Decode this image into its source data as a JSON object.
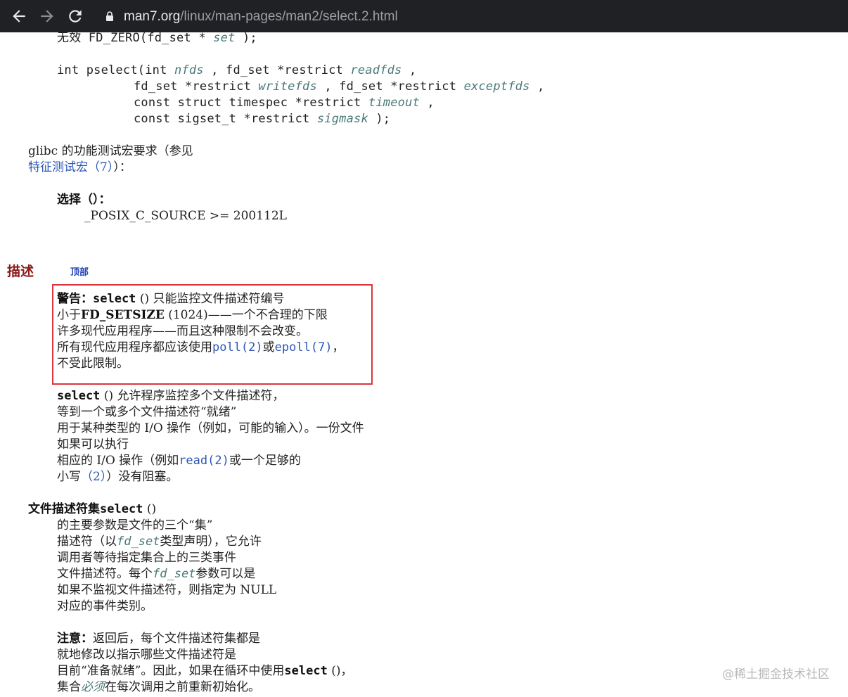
{
  "browser": {
    "url_host": "man7.org",
    "url_path": "/linux/man-pages/man2/select.2.html"
  },
  "synopsis": {
    "fdzero": {
      "prefix": "无效 FD_ZERO(fd_set * ",
      "arg": "set",
      "suffix": " );"
    },
    "pselect": [
      {
        "parts": [
          "int pselect(int ",
          "nfds",
          " , fd_set *restrict ",
          "readfds",
          " ,"
        ]
      },
      {
        "parts": [
          "fd_set *restrict ",
          "writefds",
          " , fd_set *restrict ",
          "exceptfds",
          " ,"
        ]
      },
      {
        "parts": [
          "const struct timespec *restrict ",
          "timeout",
          " ,"
        ]
      },
      {
        "parts": [
          "const sigset_t *restrict ",
          "sigmask",
          " );"
        ]
      }
    ],
    "glibc_line1": "glibc 的功能测试宏要求（参见",
    "glibc_link": "特征测试宏（7）",
    "glibc_line2_suffix": "）：",
    "select_label": "选择（）：",
    "posix": "_POSIX_C_SOURCE >= 200112L"
  },
  "description": {
    "title": "描述",
    "top_link": "顶部",
    "warning": {
      "bold_label": "警告：",
      "l1_code": "select",
      "l1_rest": " () 只能监控文件描述符编号",
      "l2_prefix": "小于",
      "l2_bold": "FD_SETSIZE",
      "l2_rest": " (1024)——一个不合理的下限",
      "l3": "许多现代应用程序——而且这种限制不会改变。",
      "l4_prefix": "所有现代应用程序都应该使用",
      "l4_link1": "poll(2)",
      "l4_mid": "或",
      "l4_link2": "epoll(7)",
      "l4_suffix": "，",
      "l5": "不受此限制。"
    },
    "para1": {
      "l1_code": "select",
      "l1_rest": " () 允许程序监控多个文件描述符，",
      "l2": "等到一个或多个文件描述符“就绪”",
      "l3": "用于某种类型的 I/O 操作（例如，可能的输入）。一份文件",
      "l4": "如果可以执行",
      "l5_prefix": "相应的 I/O 操作（例如",
      "l5_link": "read(2)",
      "l5_rest": "或一个足够的",
      "l6_prefix": "小写",
      "l6_link": "（2）",
      "l6_rest": "）没有阻塞。"
    },
    "fdsets": {
      "heading_prefix": "文件描述符集",
      "heading_code": "select",
      "heading_suffix": " ()",
      "l1": "的主要参数是文件的三个“集”",
      "l2_prefix": "描述符（以",
      "l2_it": "fd_set",
      "l2_rest": "类型声明），它允许",
      "l3": "调用者等待指定集合上的三类事件",
      "l4_prefix": "文件描述符。每个",
      "l4_it": "fd_set",
      "l4_rest": "参数可以是",
      "l5": "如果不监视文件描述符，则指定为 NULL",
      "l6": "对应的事件类别。"
    },
    "note": {
      "bold": "注意：",
      "l1_rest": "返回后，每个文件描述符集都是",
      "l2": "就地修改以指示哪些文件描述符是",
      "l3_prefix": "目前“准备就绪”。因此，如果在循环中使用",
      "l3_code": "select",
      "l3_suffix": " ()，",
      "l4_prefix": "集合",
      "l4_it": "必须",
      "l4_rest": "在每次调用之前重新初始化。"
    }
  },
  "watermark": "@稀土掘金技术社区"
}
